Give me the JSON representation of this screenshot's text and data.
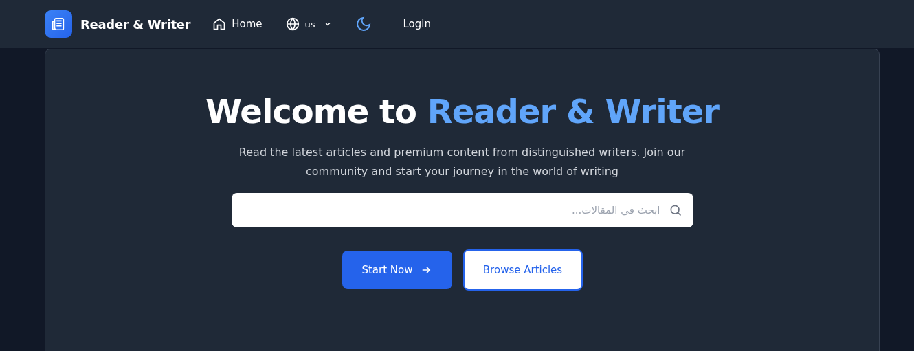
{
  "header": {
    "brand": "Reader & Writer",
    "nav": [
      {
        "kind": "home",
        "label": "Home"
      },
      {
        "kind": "language",
        "label": "us"
      },
      {
        "kind": "theme"
      },
      {
        "kind": "login",
        "label": "Login"
      }
    ]
  },
  "hero": {
    "title_lead": "Welcome to",
    "title_highlight": "Reader & Writer",
    "subtitle": "Read the latest articles and premium content from distinguished writers. Join our community and start your journey in the world of writing",
    "search": {
      "placeholder": "ابحث في المقالات..."
    },
    "buttons": [
      {
        "kind": "primary",
        "label": "Start Now"
      },
      {
        "kind": "outline",
        "label": "Browse Articles"
      }
    ]
  }
}
